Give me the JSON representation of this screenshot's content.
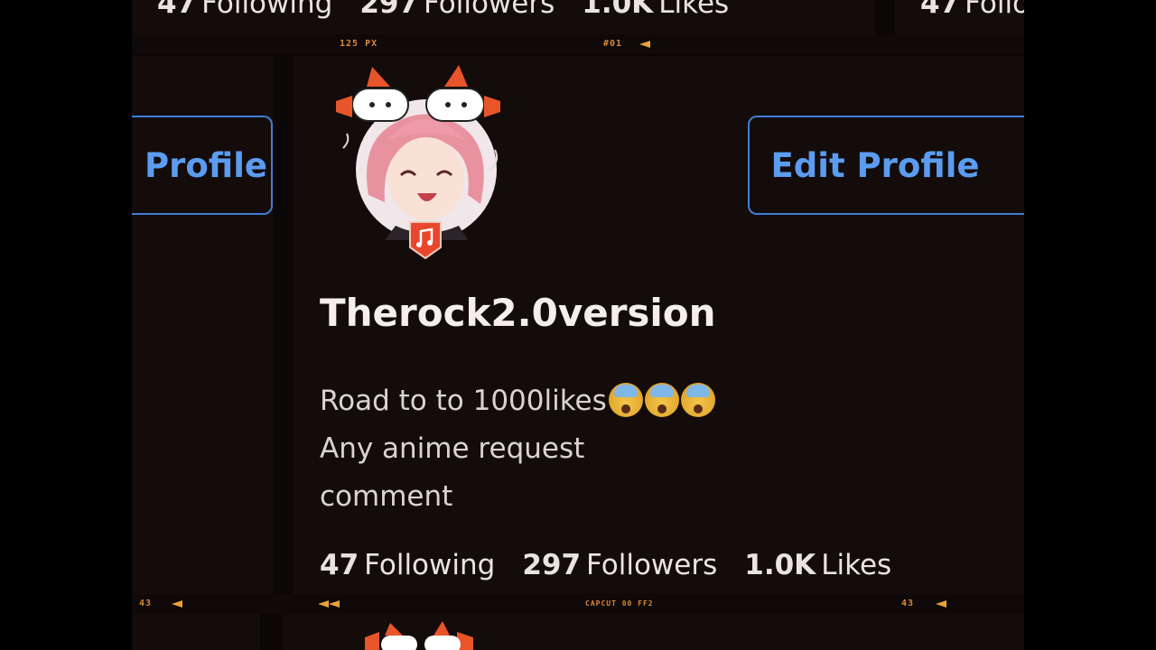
{
  "top_stats": {
    "following_count": "47",
    "following_label": "Following",
    "followers_count": "297",
    "followers_label": "Followers",
    "likes_count": "1.0K",
    "likes_label": "Likes"
  },
  "top_right_partial": {
    "count": "47",
    "label": "Follo"
  },
  "film_strip_top": {
    "px_label": "125 PX",
    "frame_label": "#01"
  },
  "film_strip_bottom": {
    "left_number": "43",
    "center_label": "CAPCUT 00 FF2",
    "right_number": "43"
  },
  "left_partial_button": {
    "label": "Profile"
  },
  "profile": {
    "edit_button_label": "Edit Profile",
    "username": "Therock2.0version",
    "bio_line1": "Road to to 1000likes",
    "bio_line2": "Any anime request",
    "bio_line3": "comment",
    "avatar_icon": "anime-avatar-icon",
    "badge_icon": "music-note-icon"
  },
  "stats": {
    "following_count": "47",
    "following_label": "Following",
    "followers_count": "297",
    "followers_label": "Followers",
    "likes_count": "1.0K",
    "likes_label": "Likes"
  },
  "colors": {
    "background": "#0b0707",
    "accent_blue": "#3f7fd8",
    "button_text": "#5b9cf0",
    "strip_text": "#d9893a"
  }
}
